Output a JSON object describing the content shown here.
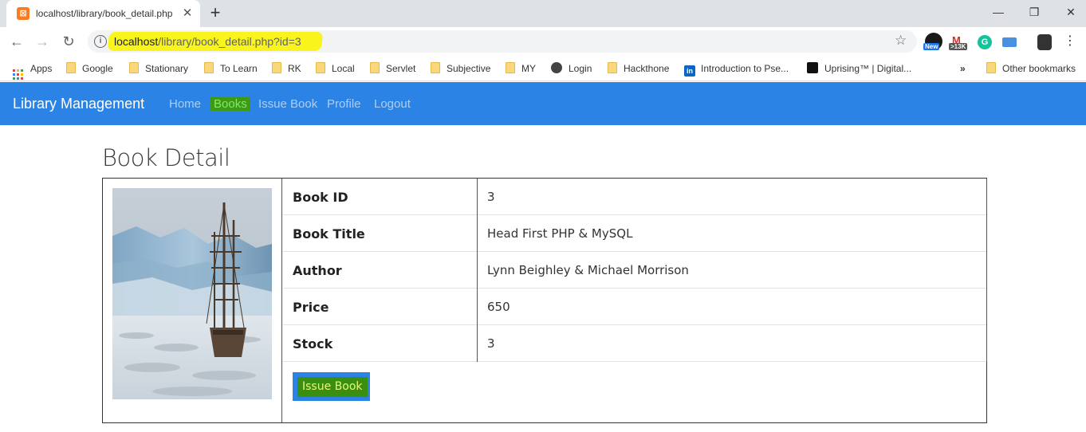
{
  "browser": {
    "tab_title": "localhost/library/book_detail.php",
    "url_host": "localhost",
    "url_path": "/library/book_detail.php?id=3",
    "extension_badges": [
      "New",
      ">13K"
    ],
    "bookmarks": [
      "Apps",
      "Google",
      "Stationary",
      "To Learn",
      "RK",
      "Local",
      "Servlet",
      "Subjective",
      "MY",
      "Login",
      "Hackthone",
      "Introduction to Pse...",
      "Uprising™ | Digital..."
    ],
    "overflow": "»",
    "other_bookmarks": "Other bookmarks"
  },
  "navbar": {
    "brand": "Library Management",
    "links": [
      "Home",
      "Books",
      "Issue Book",
      "Profile",
      "Logout"
    ],
    "active": "Books"
  },
  "page": {
    "title": "Book Detail",
    "rows": [
      {
        "label": "Book ID",
        "value": "3"
      },
      {
        "label": "Book Title",
        "value": "Head First PHP & MySQL"
      },
      {
        "label": "Author",
        "value": "Lynn Beighley & Michael Morrison"
      },
      {
        "label": "Price",
        "value": "650"
      },
      {
        "label": "Stock",
        "value": "3"
      }
    ],
    "issue_button": "Issue Book"
  },
  "colors": {
    "navbar": "#2c83e6",
    "highlight_yellow": "#f9f41b",
    "highlight_green": "#3a8f10"
  }
}
